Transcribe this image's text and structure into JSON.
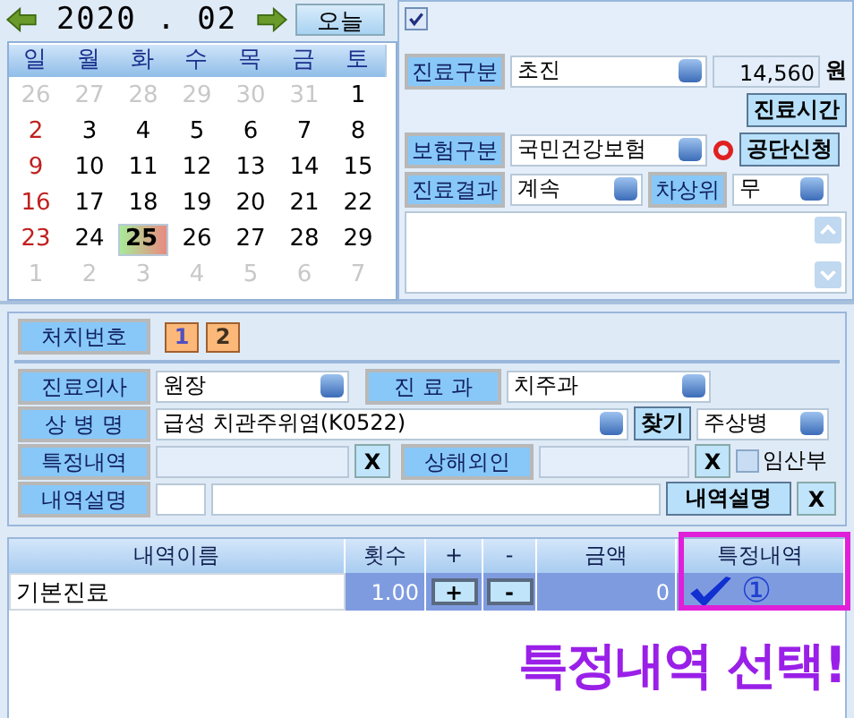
{
  "calendar": {
    "month": "2020 . 02",
    "today_button": "오늘",
    "weekdays": [
      "일",
      "월",
      "화",
      "수",
      "목",
      "금",
      "토"
    ],
    "weeks": [
      [
        {
          "day": "26",
          "muted": true,
          "selected": false
        },
        {
          "day": "27",
          "muted": true,
          "selected": false
        },
        {
          "day": "28",
          "muted": true,
          "selected": false
        },
        {
          "day": "29",
          "muted": true,
          "selected": false
        },
        {
          "day": "30",
          "muted": true,
          "selected": false
        },
        {
          "day": "31",
          "muted": true,
          "selected": false
        },
        {
          "day": "1",
          "muted": false,
          "selected": false
        }
      ],
      [
        {
          "day": "2",
          "muted": false,
          "selected": false
        },
        {
          "day": "3",
          "muted": false,
          "selected": false
        },
        {
          "day": "4",
          "muted": false,
          "selected": false
        },
        {
          "day": "5",
          "muted": false,
          "selected": false
        },
        {
          "day": "6",
          "muted": false,
          "selected": false
        },
        {
          "day": "7",
          "muted": false,
          "selected": false
        },
        {
          "day": "8",
          "muted": false,
          "selected": false
        }
      ],
      [
        {
          "day": "9",
          "muted": false,
          "selected": false
        },
        {
          "day": "10",
          "muted": false,
          "selected": false
        },
        {
          "day": "11",
          "muted": false,
          "selected": false
        },
        {
          "day": "12",
          "muted": false,
          "selected": false
        },
        {
          "day": "13",
          "muted": false,
          "selected": false
        },
        {
          "day": "14",
          "muted": false,
          "selected": false
        },
        {
          "day": "15",
          "muted": false,
          "selected": false
        }
      ],
      [
        {
          "day": "16",
          "muted": false,
          "selected": false
        },
        {
          "day": "17",
          "muted": false,
          "selected": false
        },
        {
          "day": "18",
          "muted": false,
          "selected": false
        },
        {
          "day": "19",
          "muted": false,
          "selected": false
        },
        {
          "day": "20",
          "muted": false,
          "selected": false
        },
        {
          "day": "21",
          "muted": false,
          "selected": false
        },
        {
          "day": "22",
          "muted": false,
          "selected": false
        }
      ],
      [
        {
          "day": "23",
          "muted": false,
          "selected": false
        },
        {
          "day": "24",
          "muted": false,
          "selected": false
        },
        {
          "day": "25",
          "muted": false,
          "selected": true
        },
        {
          "day": "26",
          "muted": false,
          "selected": false
        },
        {
          "day": "27",
          "muted": false,
          "selected": false
        },
        {
          "day": "28",
          "muted": false,
          "selected": false
        },
        {
          "day": "29",
          "muted": false,
          "selected": false
        }
      ],
      [
        {
          "day": "1",
          "muted": true,
          "selected": false
        },
        {
          "day": "2",
          "muted": true,
          "selected": false
        },
        {
          "day": "3",
          "muted": true,
          "selected": false
        },
        {
          "day": "4",
          "muted": true,
          "selected": false
        },
        {
          "day": "5",
          "muted": true,
          "selected": false
        },
        {
          "day": "6",
          "muted": true,
          "selected": false
        },
        {
          "day": "7",
          "muted": true,
          "selected": false
        }
      ]
    ]
  },
  "top_checkbox": {
    "checked": true
  },
  "visit": {
    "type_label": "진료구분",
    "type_value": "초진",
    "fee": "14,560",
    "fee_unit": "원",
    "time_button": "진료시간",
    "insurance_label": "보험구분",
    "insurance_value": "국민건강보험",
    "claim_button": "공단신청",
    "result_label": "진료결과",
    "result_value": "계속",
    "rank_label": "차상위",
    "rank_value": "무"
  },
  "treatment": {
    "label": "처치번호",
    "numbers": [
      {
        "label": "1",
        "selected": true
      },
      {
        "label": "2",
        "selected": false
      }
    ]
  },
  "form": {
    "doctor_label": "진료의사",
    "doctor_value": "원장",
    "dept_label": "진 료 과",
    "dept_value": "치주과",
    "disease_label": "상 병 명",
    "disease_value": "급성 치관주위염(K0522)",
    "find_button": "찾기",
    "disease_rank_value": "주상병",
    "special_label": "특정내역",
    "clear_button": "X",
    "injury_label": "상해외인",
    "injury_clear_button": "X",
    "pregnant_label": "임산부",
    "pregnant_checked": false,
    "note_label": "내역설명",
    "note_button": "내역설명",
    "note_clear_button": "X"
  },
  "table": {
    "columns": [
      "내역이름",
      "횟수",
      "+",
      "-",
      "금액",
      "특정내역"
    ],
    "rows": [
      {
        "name": "기본진료",
        "count": "1.00",
        "plus": "+",
        "minus": "-",
        "amount": "0",
        "special": true
      }
    ]
  },
  "annotation": {
    "marker": "①",
    "caption": "특정내역 선택!"
  }
}
